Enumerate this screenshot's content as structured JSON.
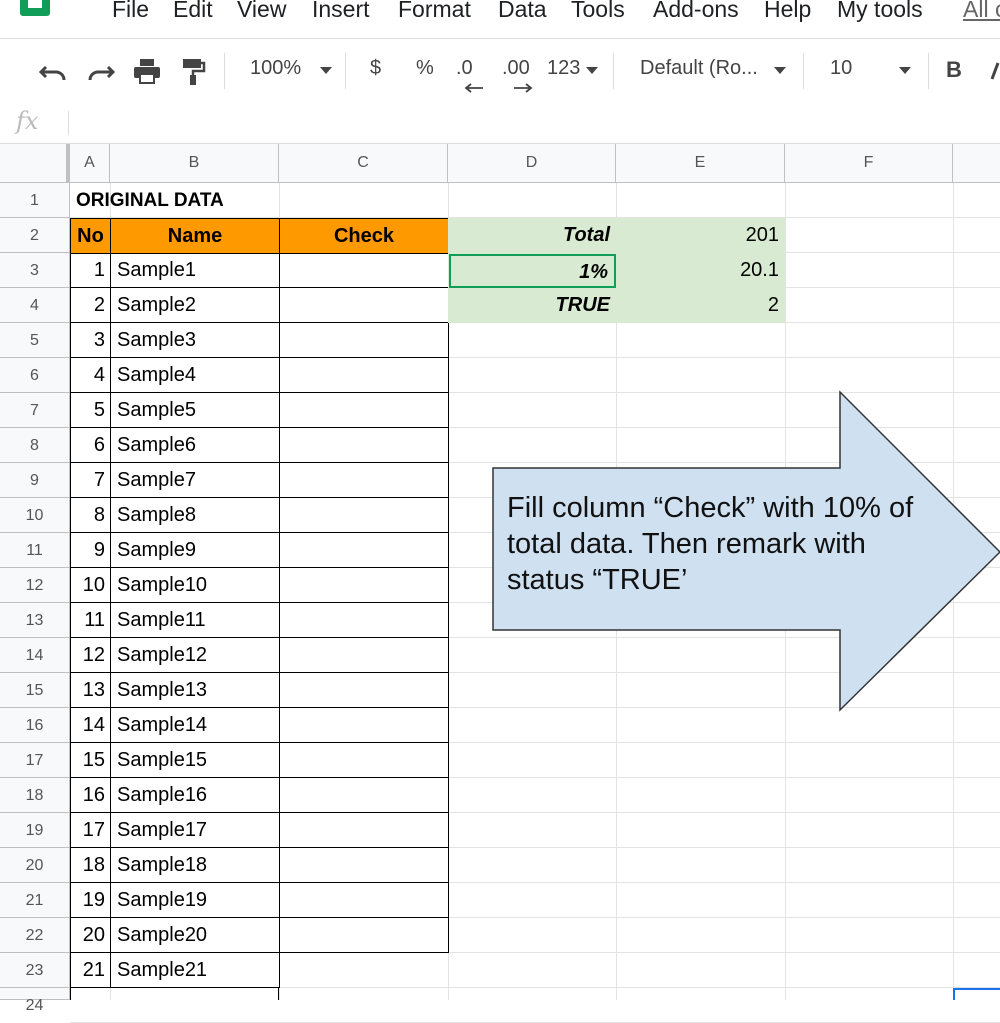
{
  "menu": [
    "File",
    "Edit",
    "View",
    "Insert",
    "Format",
    "Data",
    "Tools",
    "Add-ons",
    "Help",
    "My tools",
    "All c"
  ],
  "toolbar": {
    "zoom": "100%",
    "currency": "$",
    "percent": "%",
    "decrease_decimals": ".0",
    "increase_decimals": ".00",
    "more_formats": "123",
    "font": "Default (Ro...",
    "font_size": "10",
    "bold": "B"
  },
  "formula_bar": {
    "fx": "fx",
    "value": ""
  },
  "columns": [
    "A",
    "B",
    "C",
    "D",
    "E",
    "F"
  ],
  "sheet": {
    "title": "ORIGINAL DATA",
    "headers": {
      "no": "No",
      "name": "Name",
      "check": "Check"
    },
    "rows": [
      {
        "no": "1",
        "name": "Sample1"
      },
      {
        "no": "2",
        "name": "Sample2"
      },
      {
        "no": "3",
        "name": "Sample3"
      },
      {
        "no": "4",
        "name": "Sample4"
      },
      {
        "no": "5",
        "name": "Sample5"
      },
      {
        "no": "6",
        "name": "Sample6"
      },
      {
        "no": "7",
        "name": "Sample7"
      },
      {
        "no": "8",
        "name": "Sample8"
      },
      {
        "no": "9",
        "name": "Sample9"
      },
      {
        "no": "10",
        "name": "Sample10"
      },
      {
        "no": "11",
        "name": "Sample11"
      },
      {
        "no": "12",
        "name": "Sample12"
      },
      {
        "no": "13",
        "name": "Sample13"
      },
      {
        "no": "14",
        "name": "Sample14"
      },
      {
        "no": "15",
        "name": "Sample15"
      },
      {
        "no": "16",
        "name": "Sample16"
      },
      {
        "no": "17",
        "name": "Sample17"
      },
      {
        "no": "18",
        "name": "Sample18"
      },
      {
        "no": "19",
        "name": "Sample19"
      },
      {
        "no": "20",
        "name": "Sample20"
      },
      {
        "no": "21",
        "name": "Sample21"
      }
    ],
    "summary": [
      {
        "label": "Total",
        "value": "201"
      },
      {
        "label": "1%",
        "value": "20.1"
      },
      {
        "label": "TRUE",
        "value": "2"
      }
    ]
  },
  "callout": {
    "text": "Fill column “Check” with 10% of total data. Then remark with status “TRUE’"
  },
  "colors": {
    "header_orange": "#ff9900",
    "summary_green": "#d9ead3",
    "callout_fill": "#cfe0f1",
    "selection": "#0f9d58",
    "sheets_green": "#0f9d58"
  }
}
